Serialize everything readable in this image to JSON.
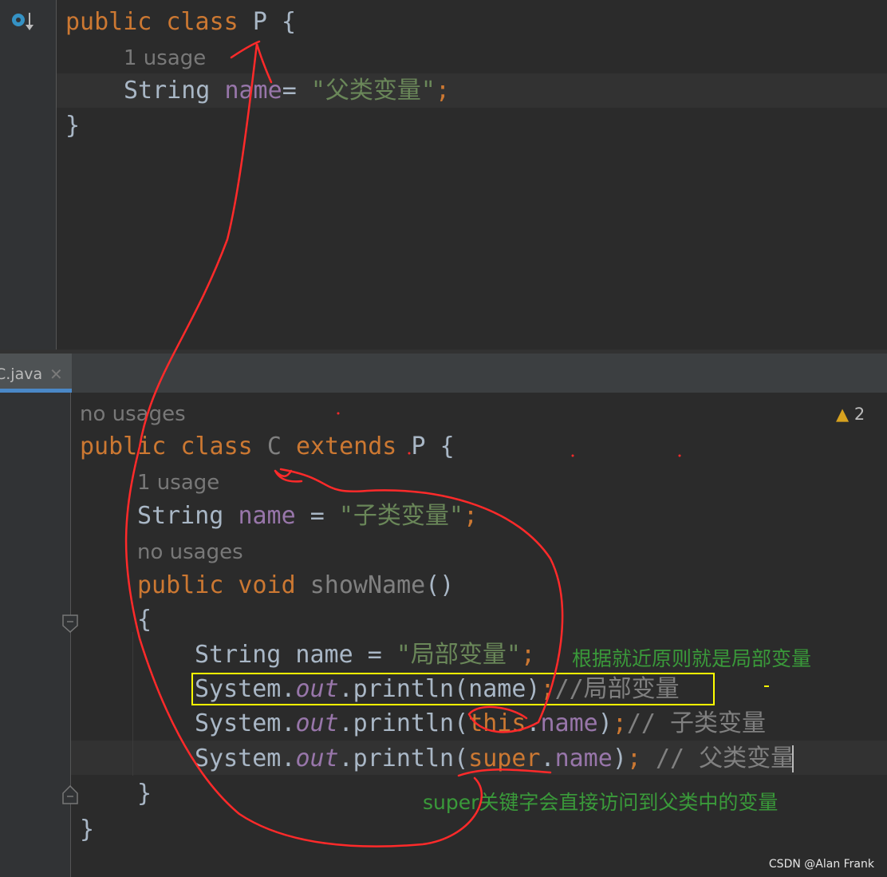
{
  "top_editor": {
    "lines": [
      [
        [
          "public class ",
          "kw"
        ],
        [
          "P ",
          "plain"
        ],
        [
          "{",
          "plain"
        ]
      ],
      [
        [
          "1 usage",
          "hint"
        ]
      ],
      [
        [
          "String ",
          "plain"
        ],
        [
          "name",
          "fld"
        ],
        [
          "= ",
          "plain"
        ],
        [
          "\"父类变量\"",
          "str"
        ],
        [
          ";",
          "kw"
        ]
      ],
      [
        [
          "}",
          "plain"
        ]
      ]
    ]
  },
  "tab": {
    "label": "C.java",
    "close_icon": "close-icon"
  },
  "inspection": {
    "icon": "warning-icon",
    "count": "2"
  },
  "bottom_editor": {
    "lines": [
      [
        [
          "no usages",
          "hint"
        ]
      ],
      [
        [
          "public class ",
          "kw"
        ],
        [
          "C ",
          "gray"
        ],
        [
          "extends ",
          "kw"
        ],
        [
          "P ",
          "plain"
        ],
        [
          "{",
          "plain"
        ]
      ],
      [
        [
          "1 usage",
          "hint"
        ]
      ],
      [
        [
          "String ",
          "plain"
        ],
        [
          "name",
          "fld"
        ],
        [
          " = ",
          "plain"
        ],
        [
          "\"子类变量\"",
          "str"
        ],
        [
          ";",
          "kw"
        ]
      ],
      [
        [
          "no usages",
          "hint"
        ]
      ],
      [
        [
          "public void ",
          "kw"
        ],
        [
          "showName",
          "gray"
        ],
        [
          "()",
          "plain"
        ]
      ],
      [
        [
          "{",
          "plain"
        ]
      ],
      [
        [
          "String name = ",
          "plain"
        ],
        [
          "\"局部变量\"",
          "str"
        ],
        [
          ";",
          "kw"
        ]
      ],
      [
        [
          "System.",
          "plain"
        ],
        [
          "out",
          "st"
        ],
        [
          ".println(name)",
          "plain"
        ],
        [
          ";",
          "kw"
        ],
        [
          "//局部变量",
          "cm"
        ]
      ],
      [
        [
          "System.",
          "plain"
        ],
        [
          "out",
          "st"
        ],
        [
          ".println(",
          "plain"
        ],
        [
          "this",
          "kw"
        ],
        [
          ".",
          "plain"
        ],
        [
          "name",
          "fld"
        ],
        [
          ")",
          "plain"
        ],
        [
          ";",
          "kw"
        ],
        [
          "// 子类变量",
          "cm"
        ]
      ],
      [
        [
          "System.",
          "plain"
        ],
        [
          "out",
          "st"
        ],
        [
          ".println(",
          "plain"
        ],
        [
          "super",
          "kw"
        ],
        [
          ".",
          "plain"
        ],
        [
          "name",
          "fld"
        ],
        [
          ")",
          "plain"
        ],
        [
          ";",
          "kw"
        ],
        [
          " // 父类变量",
          "cm"
        ]
      ],
      [
        [
          "}",
          "plain"
        ]
      ],
      [
        [
          "}",
          "plain"
        ]
      ]
    ]
  },
  "annotations": {
    "note_local": "根据就近原则就是局部变量",
    "note_super": "super关键字会直接访问到父类中的变量",
    "colors": {
      "pen": "#ff2a2a",
      "highlight_box": "#ffff00",
      "note": "#3a9a3a"
    }
  },
  "watermark": "CSDN @Alan Frank"
}
